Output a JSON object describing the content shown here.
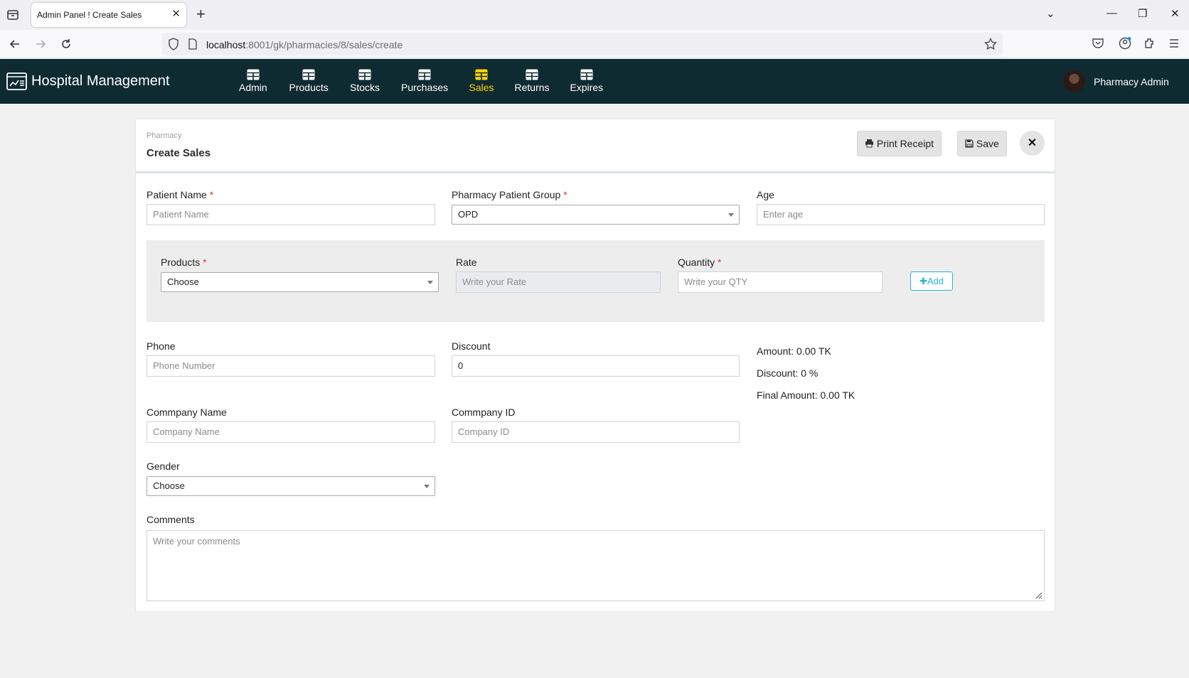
{
  "browser": {
    "tab_title": "Admin Panel ! Create Sales",
    "url_host": "localhost",
    "url_rest": ":8001/gk/pharmacies/8/sales/create"
  },
  "app": {
    "brand": "Hospital Management",
    "menu": [
      {
        "label": "Admin",
        "active": false
      },
      {
        "label": "Products",
        "active": false
      },
      {
        "label": "Stocks",
        "active": false
      },
      {
        "label": "Purchases",
        "active": false
      },
      {
        "label": "Sales",
        "active": true
      },
      {
        "label": "Returns",
        "active": false
      },
      {
        "label": "Expires",
        "active": false
      }
    ],
    "active_color": "#ffd600",
    "header_bg": "#0f2b32",
    "user_name": "Pharmacy Admin"
  },
  "page": {
    "breadcrumb": "Pharmacy",
    "title": "Create Sales",
    "print_label": "Print Receipt",
    "save_label": "Save"
  },
  "form": {
    "patient_name": {
      "label": "Patient Name",
      "placeholder": "Patient Name"
    },
    "patient_group": {
      "label": "Pharmacy Patient Group",
      "value": "OPD"
    },
    "age": {
      "label": "Age",
      "placeholder": "Enter age"
    },
    "products": {
      "label": "Products",
      "value": "Choose"
    },
    "rate": {
      "label": "Rate",
      "placeholder": "Write your Rate"
    },
    "quantity": {
      "label": "Quantity",
      "placeholder": "Write your QTY"
    },
    "add_label": "Add",
    "phone": {
      "label": "Phone",
      "placeholder": "Phone Number"
    },
    "discount": {
      "label": "Discount",
      "value": "0"
    },
    "company_name": {
      "label": "Commpany Name",
      "placeholder": "Company Name"
    },
    "company_id": {
      "label": "Commpany ID",
      "placeholder": "Company ID"
    },
    "gender": {
      "label": "Gender",
      "value": "Choose"
    },
    "comments": {
      "label": "Comments",
      "placeholder": "Write your comments"
    },
    "required_mark": "*"
  },
  "summary": {
    "amount": "Amount: 0.00 TK",
    "discount": "Discount: 0 %",
    "final_amount": "Final Amount: 0.00 TK"
  }
}
